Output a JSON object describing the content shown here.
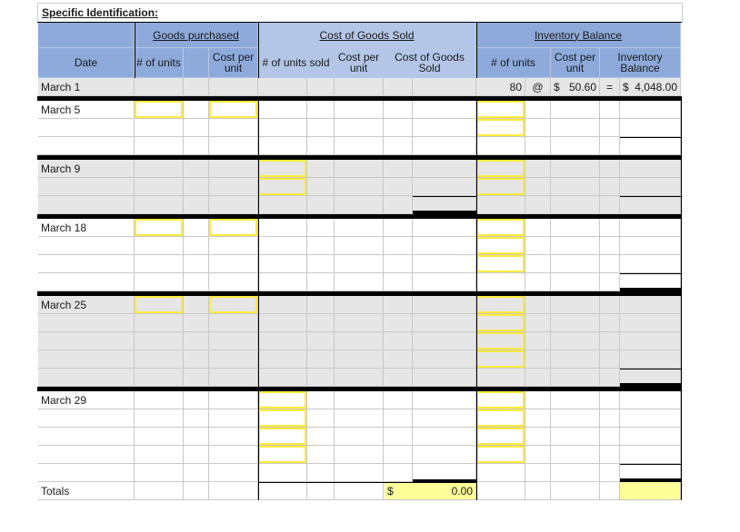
{
  "title": "Specific Identification:",
  "header": {
    "date": "Date",
    "goods_purchased": "Goods purchased",
    "cogs_group": "Cost of Goods Sold",
    "inventory_group": "Inventory Balance",
    "gp_units": "# of units",
    "gp_cost": "Cost per unit",
    "cogs_units": "# of units sold",
    "cogs_cost": "Cost per unit",
    "cogs_total": "Cost of Goods Sold",
    "inv_units": "# of units",
    "inv_cost": "Cost per unit",
    "inv_balance": "Inventory Balance"
  },
  "opening": {
    "date": "March 1",
    "units": "80",
    "at": "@",
    "cost_dollar": "$",
    "cost": "50.60",
    "equals": "=",
    "bal_dollar": "$",
    "balance": "4,048.00"
  },
  "sections": [
    {
      "date": "March 5"
    },
    {
      "date": "March 9"
    },
    {
      "date": "March 18"
    },
    {
      "date": "March 25"
    },
    {
      "date": "March 29"
    }
  ],
  "totals": {
    "label": "Totals",
    "cogs_dollar": "$",
    "cogs_value": "0.00",
    "inventory_value": ""
  },
  "colors": {
    "header_blue": "#8eaadb",
    "header_light_blue": "#b4c6e7",
    "input_outline_yellow": "#ffeb3b",
    "total_fill_yellow": "#ffff99",
    "row_gray": "#e6e6e6"
  }
}
